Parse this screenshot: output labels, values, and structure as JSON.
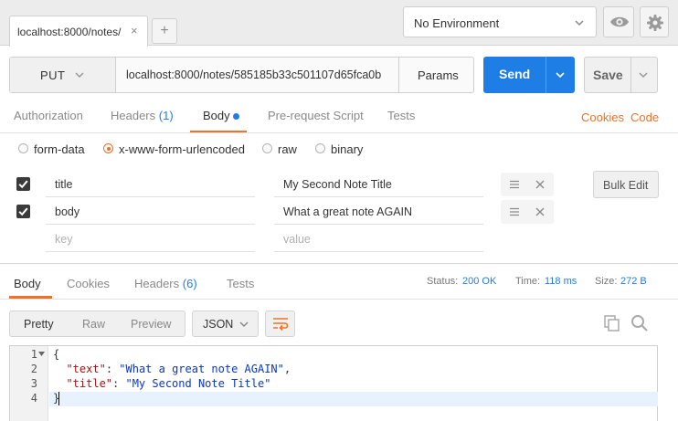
{
  "top_tab": {
    "label": "localhost:8000/notes/",
    "close_glyph": "×"
  },
  "new_tab_glyph": "+",
  "environment": {
    "selected": "No Environment"
  },
  "request": {
    "method": "PUT",
    "url": "localhost:8000/notes/585185b33c501107d65fca0b",
    "params_label": "Params",
    "send_label": "Send",
    "save_label": "Save"
  },
  "request_tabs": {
    "authorization": "Authorization",
    "headers": "Headers",
    "headers_count": "(1)",
    "body": "Body",
    "prerequest": "Pre-request Script",
    "tests": "Tests",
    "cookies": "Cookies",
    "code": "Code"
  },
  "body_types": [
    "form-data",
    "x-www-form-urlencoded",
    "raw",
    "binary"
  ],
  "body_type_selected": "x-www-form-urlencoded",
  "form_rows": [
    {
      "key": "title",
      "value": "My Second Note Title",
      "checked": true
    },
    {
      "key": "body",
      "value": "What a great note AGAIN",
      "checked": true
    }
  ],
  "form_placeholder": {
    "key": "key",
    "value": "value"
  },
  "bulk_edit_label": "Bulk Edit",
  "response_tabs": {
    "body": "Body",
    "cookies": "Cookies",
    "headers": "Headers",
    "headers_count": "(6)",
    "tests": "Tests"
  },
  "response_status": {
    "status_label": "Status:",
    "status_value": "200 OK",
    "time_label": "Time:",
    "time_value": "118 ms",
    "size_label": "Size:",
    "size_value": "272 B"
  },
  "view_modes": [
    "Pretty",
    "Raw",
    "Preview"
  ],
  "format_selected": "JSON",
  "code_lines": [
    {
      "no": "1",
      "text": "{"
    },
    {
      "no": "2",
      "key": "\"text\"",
      "value": "\"What a great note AGAIN\"",
      "trail": ","
    },
    {
      "no": "3",
      "key": "\"title\"",
      "value": "\"My Second Note Title\"",
      "trail": ""
    },
    {
      "no": "4",
      "text": "}"
    }
  ],
  "colors": {
    "accent": "#f47023",
    "primary": "#1f7de6"
  },
  "icons": [
    "close-icon",
    "plus-icon",
    "chevron-down-icon",
    "eye-icon",
    "gear-icon",
    "drag-handle-icon",
    "delete-icon",
    "wrap-lines-icon",
    "copy-icon",
    "search-icon",
    "checkbox-checked-icon",
    "fold-arrow-icon"
  ]
}
